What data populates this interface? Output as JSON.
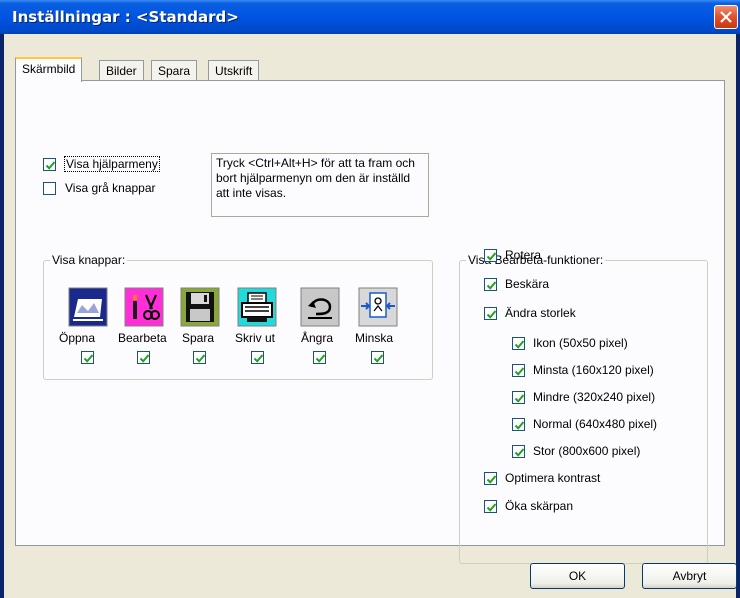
{
  "window": {
    "title": "Inställningar : <Standard>"
  },
  "tabs": [
    "Skärmbild",
    "Bilder",
    "Spara",
    "Utskrift"
  ],
  "display": {
    "show_help_menu": {
      "label": "Visa hjälparmeny",
      "checked": true
    },
    "show_gray_buttons": {
      "label": "Visa grå knappar",
      "checked": false
    },
    "info_text": "Tryck <Ctrl+Alt+H> för att ta fram och bort hjälparmenyn om den är inställd att inte visas."
  },
  "buttons_group": {
    "title": "Visa knappar:",
    "items": [
      {
        "label": "Öppna",
        "checked": true,
        "icon": "open-folder-icon"
      },
      {
        "label": "Bearbeta",
        "checked": true,
        "icon": "edit-tools-icon"
      },
      {
        "label": "Spara",
        "checked": true,
        "icon": "floppy-disk-icon"
      },
      {
        "label": "Skriv ut",
        "checked": true,
        "icon": "printer-icon"
      },
      {
        "label": "Ångra",
        "checked": true,
        "icon": "undo-icon"
      },
      {
        "label": "Minska",
        "checked": true,
        "icon": "shrink-icon"
      }
    ]
  },
  "edit_group": {
    "title": "Visa Bearbeta-funktioner:",
    "items": [
      {
        "label": "Rotera",
        "checked": true
      },
      {
        "label": "Beskära",
        "checked": true
      },
      {
        "label": "Ändra storlek",
        "checked": true
      },
      {
        "label": "Ikon (50x50 pixel)",
        "checked": true
      },
      {
        "label": "Minsta (160x120 pixel)",
        "checked": true
      },
      {
        "label": "Mindre (320x240 pixel)",
        "checked": true
      },
      {
        "label": "Normal (640x480 pixel)",
        "checked": true
      },
      {
        "label": "Stor (800x600 pixel)",
        "checked": true
      },
      {
        "label": "Optimera kontrast",
        "checked": true
      },
      {
        "label": "Öka skärpan",
        "checked": true
      }
    ]
  },
  "footer": {
    "ok": "OK",
    "cancel": "Avbryt"
  }
}
